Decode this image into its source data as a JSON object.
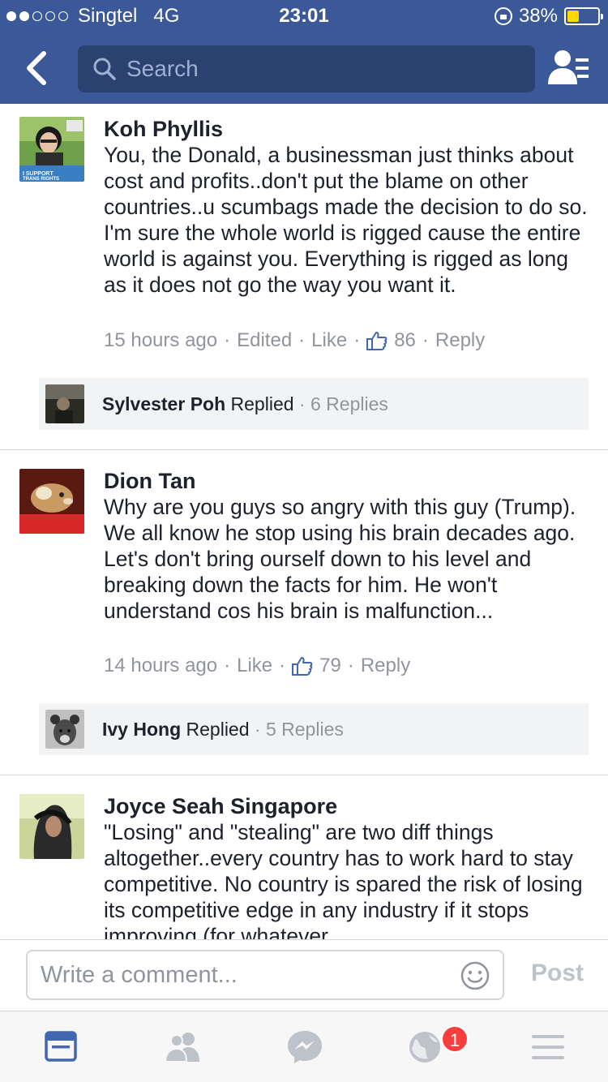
{
  "status_bar": {
    "carrier": "Singtel",
    "network": "4G",
    "time": "23:01",
    "battery": "38%",
    "battery_level": 0.38
  },
  "nav": {
    "search_placeholder": "Search"
  },
  "comments": [
    {
      "author": "Koh Phyllis",
      "text": "You, the Donald, a businessman just thinks about cost and profits..don't put the blame on other countries..u scumbags made the decision to do so. I'm sure the whole world is rigged cause the entire world is against you. Everything is rigged as long as it does not go the way you want it.",
      "time": "15 hours ago",
      "edited": "Edited",
      "like": "Like",
      "likes": "86",
      "reply": "Reply",
      "replied_by": "Sylvester Poh",
      "replied_word": "Replied",
      "replies": "6 Replies"
    },
    {
      "author": "Dion Tan",
      "text": "Why are you guys so angry with this guy (Trump). We all know he stop using his brain decades ago. Let's don't bring ourself down to his level and breaking down the facts for him. He won't understand cos his brain is malfunction...",
      "time": "14 hours ago",
      "like": "Like",
      "likes": "79",
      "reply": "Reply",
      "replied_by": "Ivy Hong",
      "replied_word": "Replied",
      "replies": "5 Replies"
    },
    {
      "author": "Joyce Seah Singapore",
      "text": "\"Losing\" and \"stealing\" are two diff things altogether..every country has to work hard to stay competitive. No country is spared the risk of losing its competitive edge in any industry if it stops improving (for whatever"
    }
  ],
  "composer": {
    "placeholder": "Write a comment...",
    "post_label": "Post"
  },
  "tabbar": {
    "notifications_badge": "1"
  },
  "colors": {
    "brand": "#3b5998",
    "badge": "#fa3e3e",
    "battery_fill": "#ffd800"
  }
}
